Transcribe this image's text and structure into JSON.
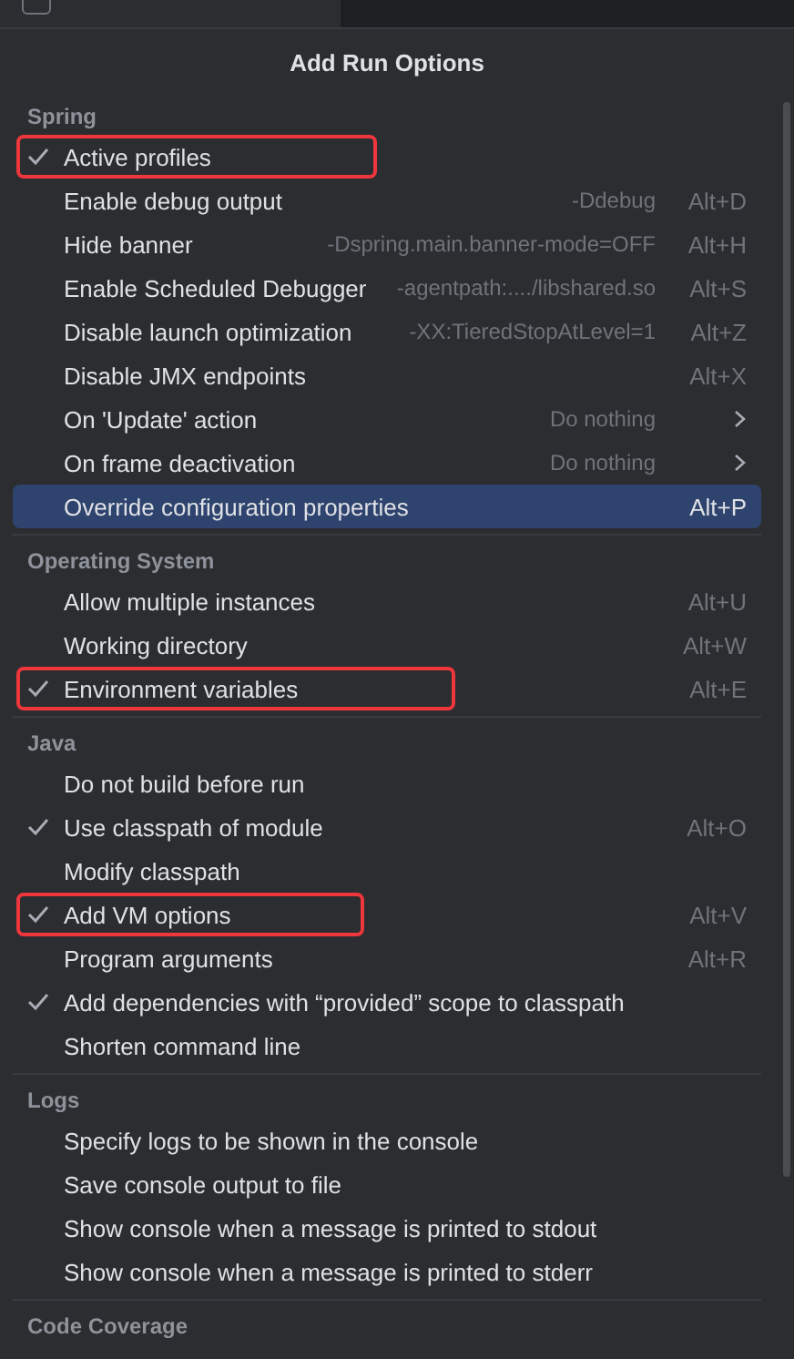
{
  "background_checkbox": {
    "checked": false
  },
  "popup": {
    "title": "Add Run Options"
  },
  "sections": [
    {
      "header": "Spring",
      "items": [
        {
          "label": "Active profiles",
          "checked": true,
          "highlighted": true,
          "selected": false
        },
        {
          "label": "Enable debug output",
          "hint": "-Ddebug",
          "shortcut": "Alt+D",
          "checked": false,
          "highlighted": false,
          "selected": false
        },
        {
          "label": "Hide banner",
          "hint": "-Dspring.main.banner-mode=OFF",
          "shortcut": "Alt+H",
          "checked": false,
          "highlighted": false,
          "selected": false
        },
        {
          "label": "Enable Scheduled Debugger",
          "hint": "-agentpath:..../libshared.so",
          "shortcut": "Alt+S",
          "checked": false,
          "highlighted": false,
          "selected": false
        },
        {
          "label": "Disable launch optimization",
          "hint": "-XX:TieredStopAtLevel=1",
          "shortcut": "Alt+Z",
          "checked": false,
          "highlighted": false,
          "selected": false
        },
        {
          "label": "Disable JMX endpoints",
          "shortcut": "Alt+X",
          "checked": false,
          "highlighted": false,
          "selected": false
        },
        {
          "label": "On 'Update' action",
          "hint": "Do nothing",
          "submenu": true,
          "checked": false,
          "highlighted": false,
          "selected": false
        },
        {
          "label": "On frame deactivation",
          "hint": "Do nothing",
          "submenu": true,
          "checked": false,
          "highlighted": false,
          "selected": false
        },
        {
          "label": "Override configuration properties",
          "shortcut": "Alt+P",
          "checked": false,
          "highlighted": false,
          "selected": true
        }
      ]
    },
    {
      "header": "Operating System",
      "items": [
        {
          "label": "Allow multiple instances",
          "shortcut": "Alt+U",
          "checked": false,
          "highlighted": false,
          "selected": false
        },
        {
          "label": "Working directory",
          "shortcut": "Alt+W",
          "checked": false,
          "highlighted": false,
          "selected": false
        },
        {
          "label": "Environment variables",
          "shortcut": "Alt+E",
          "checked": true,
          "highlighted": true,
          "selected": false
        }
      ]
    },
    {
      "header": "Java",
      "items": [
        {
          "label": "Do not build before run",
          "checked": false,
          "highlighted": false,
          "selected": false
        },
        {
          "label": "Use classpath of module",
          "shortcut": "Alt+O",
          "checked": true,
          "highlighted": false,
          "selected": false
        },
        {
          "label": "Modify classpath",
          "checked": false,
          "highlighted": false,
          "selected": false
        },
        {
          "label": "Add VM options",
          "shortcut": "Alt+V",
          "checked": true,
          "highlighted": true,
          "selected": false
        },
        {
          "label": "Program arguments",
          "shortcut": "Alt+R",
          "checked": false,
          "highlighted": false,
          "selected": false
        },
        {
          "label": "Add dependencies with “provided” scope to classpath",
          "checked": true,
          "highlighted": false,
          "selected": false
        },
        {
          "label": "Shorten command line",
          "checked": false,
          "highlighted": false,
          "selected": false
        }
      ]
    },
    {
      "header": "Logs",
      "items": [
        {
          "label": "Specify logs to be shown in the console",
          "checked": false,
          "highlighted": false,
          "selected": false
        },
        {
          "label": "Save console output to file",
          "checked": false,
          "highlighted": false,
          "selected": false
        },
        {
          "label": "Show console when a message is printed to stdout",
          "checked": false,
          "highlighted": false,
          "selected": false
        },
        {
          "label": "Show console when a message is printed to stderr",
          "checked": false,
          "highlighted": false,
          "selected": false
        }
      ]
    },
    {
      "header": "Code Coverage"
    }
  ]
}
